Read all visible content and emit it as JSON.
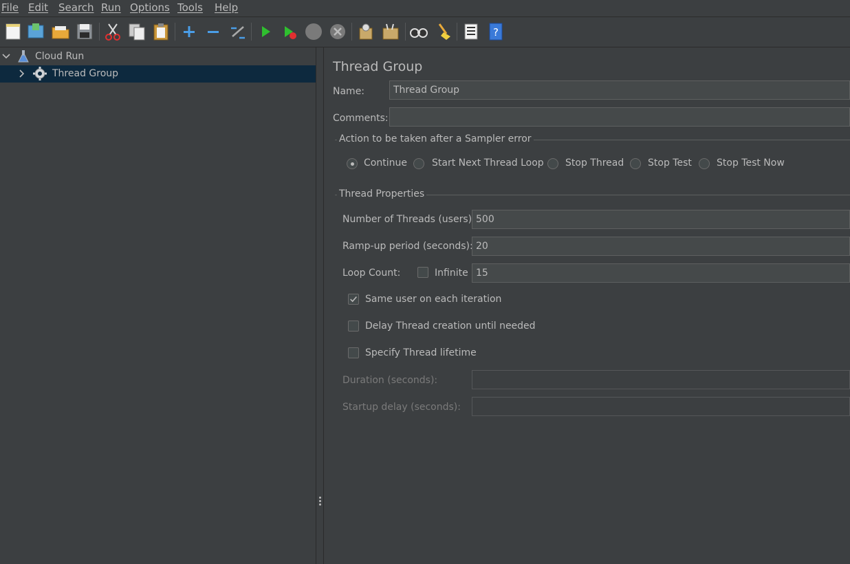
{
  "menu": [
    "File",
    "Edit",
    "Search",
    "Run",
    "Options",
    "Tools",
    "Help"
  ],
  "toolbar": {
    "icons": [
      "new-icon",
      "templates-icon",
      "open-icon",
      "save-icon",
      "cut-icon",
      "copy-icon",
      "paste-icon",
      "expand-icon",
      "collapse-icon",
      "toggle-icon",
      "start-icon",
      "start-no-pauses-icon",
      "stop-icon",
      "shutdown-icon",
      "clear-icon",
      "clear-all-icon",
      "search-icon",
      "reset-search-icon",
      "function-helper-icon",
      "help-icon"
    ]
  },
  "tree": {
    "root": {
      "label": "Cloud Run",
      "icon": "flask-icon",
      "expanded": true
    },
    "children": [
      {
        "label": "Thread Group",
        "icon": "gear-icon",
        "selected": true,
        "expanded": false
      }
    ]
  },
  "panel": {
    "title": "Thread Group",
    "name_label": "Name:",
    "name_value": "Thread Group",
    "comments_label": "Comments:",
    "comments_value": "",
    "sampler_error": {
      "title": "Action to be taken after a Sampler error",
      "options": [
        "Continue",
        "Start Next Thread Loop",
        "Stop Thread",
        "Stop Test",
        "Stop Test Now"
      ],
      "selected": "Continue"
    },
    "thread_props": {
      "title": "Thread Properties",
      "threads_label": "Number of Threads (users):",
      "threads_value": "500",
      "rampup_label": "Ramp-up period (seconds):",
      "rampup_value": "20",
      "loop_label": "Loop Count:",
      "infinite_label": "Infinite",
      "infinite_checked": false,
      "loop_value": "15",
      "same_user_label": "Same user on each iteration",
      "same_user_checked": true,
      "delay_label": "Delay Thread creation until needed",
      "delay_checked": false,
      "lifetime_label": "Specify Thread lifetime",
      "lifetime_checked": false,
      "duration_label": "Duration (seconds):",
      "duration_value": "",
      "startup_label": "Startup delay (seconds):",
      "startup_value": ""
    }
  }
}
